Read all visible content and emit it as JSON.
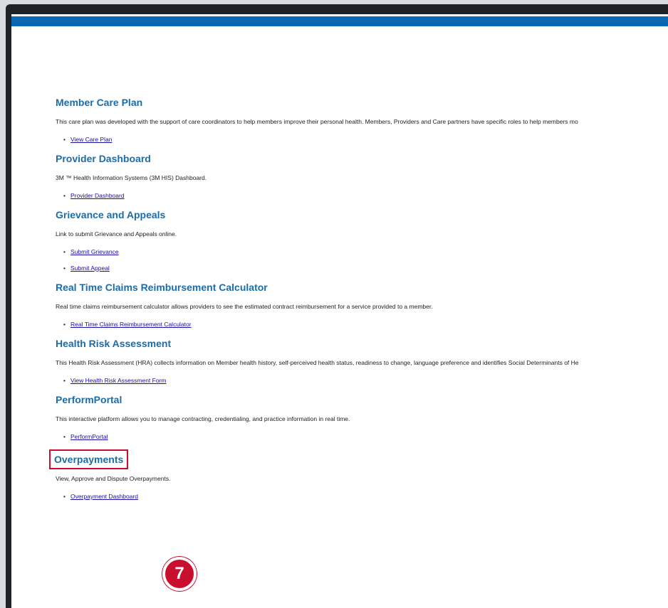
{
  "colors": {
    "accent_bar": "#0a67b1",
    "heading": "#1b6ca8",
    "link": "#1a0dab",
    "highlight": "#c8102e"
  },
  "sections": [
    {
      "title": "Member Care Plan",
      "description": "This care plan was developed with the support of care coordinators to help members improve their personal health. Members, Providers and Care partners have specific roles to help members mo",
      "links": [
        "View Care Plan"
      ]
    },
    {
      "title": "Provider Dashboard",
      "description": "3M ™ Health Information Systems (3M HIS) Dashboard.",
      "links": [
        "Provider Dashboard"
      ]
    },
    {
      "title": "Grievance and Appeals",
      "description": "Link to submit Grievance and Appeals online.",
      "links": [
        "Submit Grievance",
        "Submit Appeal"
      ]
    },
    {
      "title": "Real Time Claims Reimbursement Calculator",
      "description": "Real time claims reimbursement calculator allows providers to see the estimated contract reimbursement for a service provided to a member.",
      "links": [
        "Real Time Claims Reimbursement Calculator"
      ]
    },
    {
      "title": "Health Risk Assessment",
      "description": "This Health Risk Assessment (HRA) collects information on Member health history, self-perceived health status, readiness to change, language preference and identifies Social Determinants of He",
      "links": [
        "View Health Risk Assessment Form"
      ]
    },
    {
      "title": "PerformPortal",
      "description": "This interactive platform allows you to manage contracting, credentialing, and practice information in real time.",
      "links": [
        "PerformPortal"
      ]
    },
    {
      "title": "Overpayments",
      "description": "View, Approve and Dispute Overpayments.",
      "links": [
        "Overpayment Dashboard"
      ]
    }
  ],
  "step_badge": "7"
}
